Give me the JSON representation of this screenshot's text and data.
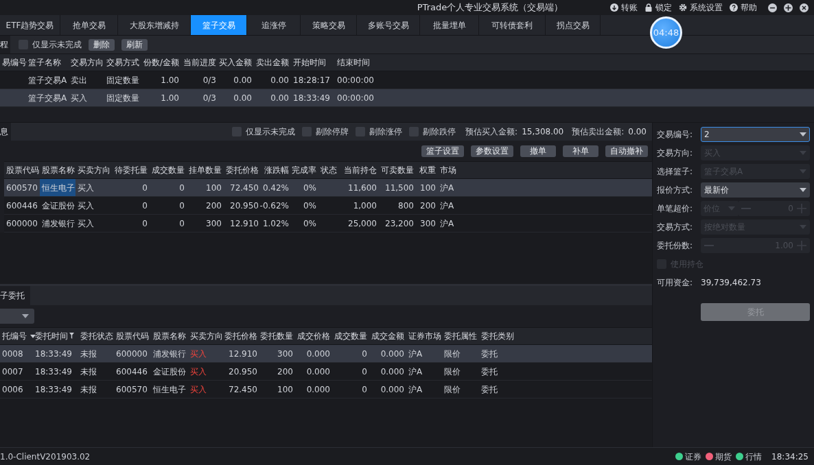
{
  "window": {
    "title": "PTrade个人专业交易系统（交易端）",
    "menu": [
      {
        "label": "转账"
      },
      {
        "label": "锁定"
      },
      {
        "label": "系统设置"
      },
      {
        "label": "帮助"
      }
    ]
  },
  "tabs": [
    {
      "label": "ETF趋势交易",
      "selected": false
    },
    {
      "label": "抢单交易",
      "selected": false
    },
    {
      "label": "大股东增减持",
      "selected": false
    },
    {
      "label": "篮子交易",
      "selected": true
    },
    {
      "label": "追涨停",
      "selected": false
    },
    {
      "label": "策略交易",
      "selected": false
    },
    {
      "label": "多账号交易",
      "selected": false
    },
    {
      "label": "批量埋单",
      "selected": false
    },
    {
      "label": "可转债套利",
      "selected": false
    },
    {
      "label": "拐点交易",
      "selected": false
    }
  ],
  "timer": "04:48",
  "basket_list": {
    "tab": "程",
    "only_unfinished": {
      "label": "仅显示未完成",
      "checked": false
    },
    "buttons": [
      "删除",
      "刷新"
    ],
    "columns": [
      {
        "label": "易编号",
        "kind": "text"
      },
      {
        "label": "篮子名称",
        "kind": "text"
      },
      {
        "label": "交易方向",
        "kind": "text"
      },
      {
        "label": "交易方式",
        "kind": "text"
      },
      {
        "label": "份数/金额",
        "kind": "num"
      },
      {
        "label": "当前进度",
        "kind": "num"
      },
      {
        "label": "买入金额",
        "kind": "num"
      },
      {
        "label": "卖出金额",
        "kind": "num"
      },
      {
        "label": "开始时间",
        "kind": "text"
      },
      {
        "label": "结束时间",
        "kind": "text"
      }
    ],
    "rows": [
      {
        "selected": false,
        "cells": [
          "",
          "篮子交易A",
          "卖出",
          "固定数量",
          "1.00",
          "0/3",
          "0.00",
          "0.00",
          "18:28:17",
          "00:00:00"
        ]
      },
      {
        "selected": true,
        "cells": [
          "",
          "篮子交易A",
          "买入",
          "固定数量",
          "1.00",
          "0/3",
          "0.00",
          "0.00",
          "18:33:49",
          "00:00:00"
        ]
      }
    ]
  },
  "basket_detail": {
    "tab": "息",
    "filters": [
      {
        "label": "仅显示未完成",
        "checked": false
      },
      {
        "label": "剔除停牌",
        "checked": false
      },
      {
        "label": "剔除涨停",
        "checked": false
      },
      {
        "label": "剔除跌停",
        "checked": false
      }
    ],
    "estimates": [
      {
        "label": "预估买入金额:",
        "value": "15,308.00"
      },
      {
        "label": "预估卖出金额:",
        "value": "0.00"
      }
    ],
    "buttons": [
      "篮子设置",
      "参数设置",
      "撤单",
      "补单",
      "自动撤补"
    ],
    "columns": [
      {
        "label": "股票代码",
        "kind": "text"
      },
      {
        "label": "股票名称",
        "kind": "text"
      },
      {
        "label": "买卖方向",
        "kind": "text"
      },
      {
        "label": "待委托量",
        "kind": "num"
      },
      {
        "label": "成交数量",
        "kind": "num"
      },
      {
        "label": "挂单数量",
        "kind": "num"
      },
      {
        "label": "委托价格",
        "kind": "num"
      },
      {
        "label": "涨跌幅",
        "kind": "num"
      },
      {
        "label": "完成率",
        "kind": "num"
      },
      {
        "label": "状态",
        "kind": "text"
      },
      {
        "label": "当前持仓",
        "kind": "num"
      },
      {
        "label": "可卖数量",
        "kind": "num"
      },
      {
        "label": "权重",
        "kind": "num"
      },
      {
        "label": "市场",
        "kind": "text"
      }
    ],
    "rows": [
      {
        "selected": true,
        "cells": [
          "600570",
          {
            "text": "恒生电子",
            "focused": true
          },
          "买入",
          "0",
          "0",
          "100",
          "72.450",
          "0.42%",
          "0%",
          "",
          "11,600",
          "11,500",
          "100",
          "沪A"
        ]
      },
      {
        "selected": false,
        "cells": [
          "600446",
          "金证股份",
          "买入",
          "0",
          "0",
          "200",
          "20.950",
          "-0.62%",
          "0%",
          "",
          "1,000",
          "800",
          "200",
          "沪A"
        ]
      },
      {
        "selected": false,
        "cells": [
          "600000",
          "浦发银行",
          "买入",
          "0",
          "0",
          "300",
          "12.910",
          "1.02%",
          "0%",
          "",
          "25,000",
          "23,200",
          "300",
          "沪A"
        ]
      }
    ]
  },
  "orders": {
    "tab": "子委托",
    "columns": [
      {
        "label": "托编号",
        "kind": "text",
        "sorted": true
      },
      {
        "label": "委托时间",
        "kind": "text",
        "filtered": true
      },
      {
        "label": "委托状态",
        "kind": "text"
      },
      {
        "label": "股票代码",
        "kind": "text"
      },
      {
        "label": "股票名称",
        "kind": "text"
      },
      {
        "label": "买卖方向",
        "kind": "side"
      },
      {
        "label": "委托价格",
        "kind": "num"
      },
      {
        "label": "委托数量",
        "kind": "num"
      },
      {
        "label": "成交价格",
        "kind": "num"
      },
      {
        "label": "成交数量",
        "kind": "num"
      },
      {
        "label": "成交金额",
        "kind": "num"
      },
      {
        "label": "证券市场",
        "kind": "text"
      },
      {
        "label": "委托属性",
        "kind": "text"
      },
      {
        "label": "委托类别",
        "kind": "text"
      }
    ],
    "rows": [
      {
        "selected": true,
        "cells": [
          "0008",
          "18:33:49",
          "未报",
          "600000",
          "浦发银行",
          "买入",
          "12.910",
          "300",
          "0.000",
          "0",
          "0.000",
          "沪A",
          "限价",
          "委托"
        ]
      },
      {
        "selected": false,
        "cells": [
          "0007",
          "18:33:49",
          "未报",
          "600446",
          "金证股份",
          "买入",
          "20.950",
          "200",
          "0.000",
          "0",
          "0.000",
          "沪A",
          "限价",
          "委托"
        ]
      },
      {
        "selected": false,
        "cells": [
          "0006",
          "18:33:49",
          "未报",
          "600570",
          "恒生电子",
          "买入",
          "72.450",
          "100",
          "0.000",
          "0",
          "0.000",
          "沪A",
          "限价",
          "委托"
        ]
      }
    ]
  },
  "order_form": {
    "fields": [
      {
        "kind": "select",
        "label": "交易编号:",
        "value": "2",
        "disabled": false,
        "focused": true
      },
      {
        "kind": "select",
        "label": "交易方向:",
        "value": "买入",
        "disabled": true,
        "focused": false
      },
      {
        "kind": "select",
        "label": "选择篮子:",
        "value": "篮子交易A",
        "disabled": true,
        "focused": false
      },
      {
        "kind": "select",
        "label": "报价方式:",
        "value": "最新价",
        "disabled": false,
        "focused": false
      },
      {
        "kind": "price_stepper",
        "label": "单笔超价:",
        "unit": "价位",
        "value": "0",
        "disabled": true
      },
      {
        "kind": "select",
        "label": "交易方式:",
        "value": "按绝对数量",
        "disabled": true,
        "focused": false
      },
      {
        "kind": "stepper",
        "label": "委托份数:",
        "value": "1.00",
        "disabled": true
      },
      {
        "kind": "checkbox",
        "label": "使用持仓",
        "checked": false,
        "disabled": true
      },
      {
        "kind": "value",
        "label": "可用资金:",
        "value": "39,739,462.73"
      },
      {
        "kind": "button",
        "label": "委托",
        "disabled": true
      }
    ]
  },
  "status_bar": {
    "version": "1.0-ClientV201903.02",
    "indicators": [
      {
        "label": "证券",
        "color": "#3ecf8e"
      },
      {
        "label": "期货",
        "color": "#f0607a"
      },
      {
        "label": "行情",
        "color": "#3ecf8e"
      }
    ],
    "time": "18:34:25"
  }
}
